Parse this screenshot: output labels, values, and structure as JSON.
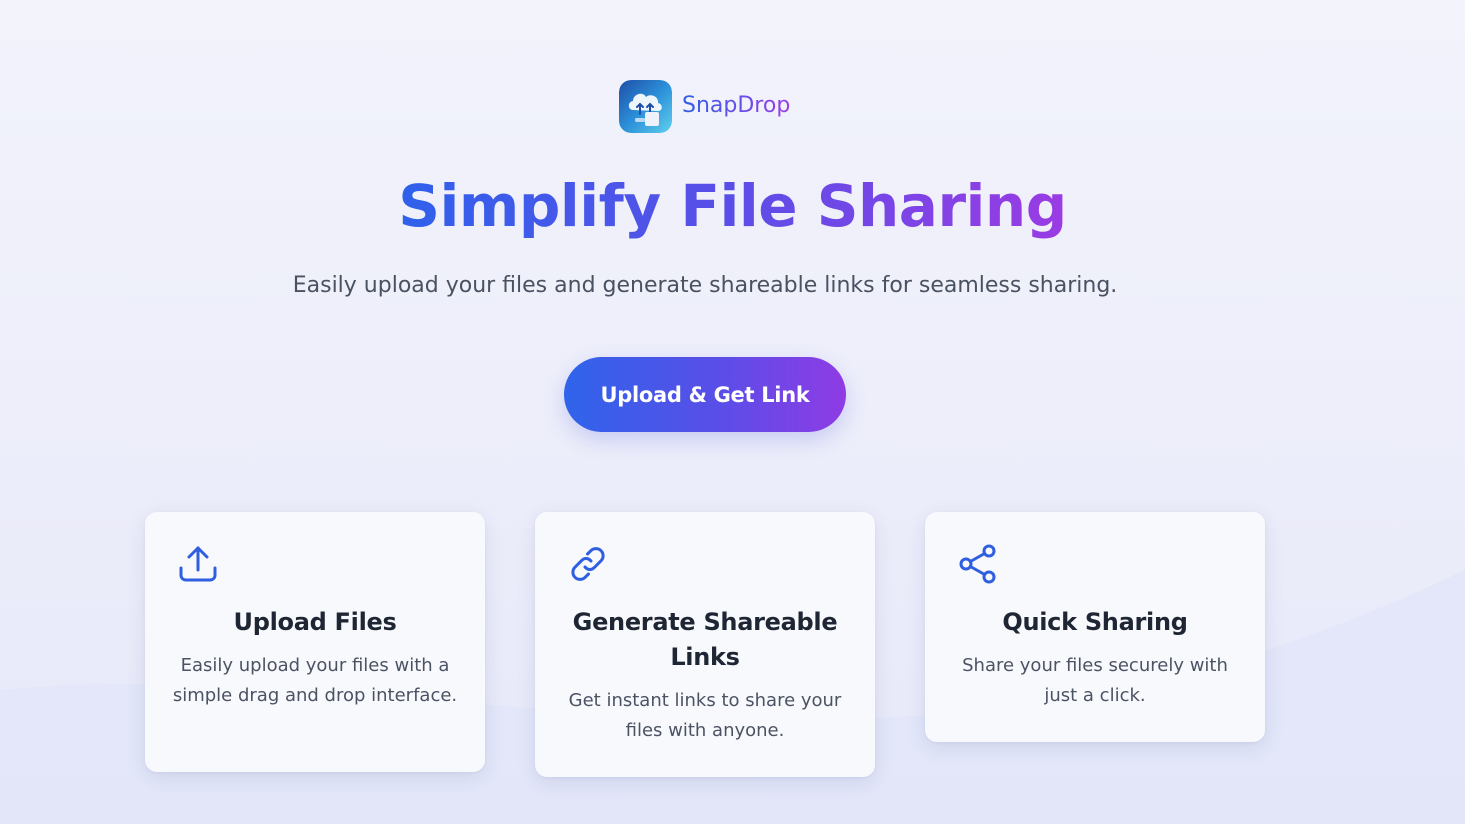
{
  "brand": {
    "name": "SnapDrop",
    "logo_icon": "cloud-upload-icon"
  },
  "hero": {
    "title": "Simplify File Sharing",
    "subtitle": "Easily upload your files and generate shareable links for seamless sharing.",
    "cta_label": "Upload & Get Link"
  },
  "features": [
    {
      "icon": "upload-icon",
      "title": "Upload Files",
      "description": "Easily upload your files with a simple drag and drop interface."
    },
    {
      "icon": "link-icon",
      "title": "Generate Shareable Links",
      "description": "Get instant links to share your files with anyone."
    },
    {
      "icon": "share-icon",
      "title": "Quick Sharing",
      "description": "Share your files securely with just a click."
    }
  ],
  "colors": {
    "accent_blue": "#2f64ea",
    "accent_purple": "#9b3be3",
    "icon_blue": "#2f5fe0",
    "background": "#f0f1fb",
    "card": "#f8f9fd"
  }
}
